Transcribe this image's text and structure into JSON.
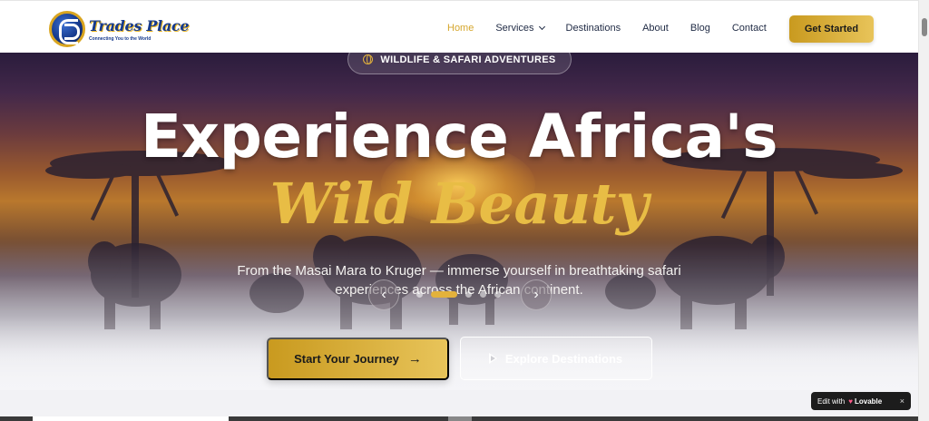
{
  "brand": {
    "name": "Trades Place",
    "tagline": "Connecting You to the World"
  },
  "nav": {
    "items": [
      {
        "label": "Home"
      },
      {
        "label": "Services"
      },
      {
        "label": "Destinations"
      },
      {
        "label": "About"
      },
      {
        "label": "Blog"
      },
      {
        "label": "Contact"
      }
    ],
    "active": "Home",
    "cta": "Get Started"
  },
  "hero": {
    "badge": "WILDLIFE & SAFARI ADVENTURES",
    "title_line1": "Experience Africa's",
    "title_line2": "Wild Beauty",
    "subtitle": "From the Masai Mara to Kruger — immerse yourself in breathtaking safari experiences across the African continent.",
    "carousel": {
      "slide_count": 6,
      "active_slide": 2
    },
    "primary_button": "Start Your Journey",
    "secondary_button": "Explore Destinations"
  },
  "lovable": {
    "prefix": "Edit with",
    "brand": "Lovable",
    "close": "×"
  },
  "colors": {
    "accent": "#e3b23c",
    "nav_active": "#d6a72e",
    "title_gold": "#e8bd45",
    "text_dark": "#1f2a44"
  },
  "icons": {
    "badge": "globe-icon",
    "services": "chevron-down-icon",
    "prev": "chevron-left-icon",
    "next": "chevron-right-icon",
    "primary": "arrow-right-icon",
    "secondary": "play-icon",
    "close": "close-icon"
  }
}
